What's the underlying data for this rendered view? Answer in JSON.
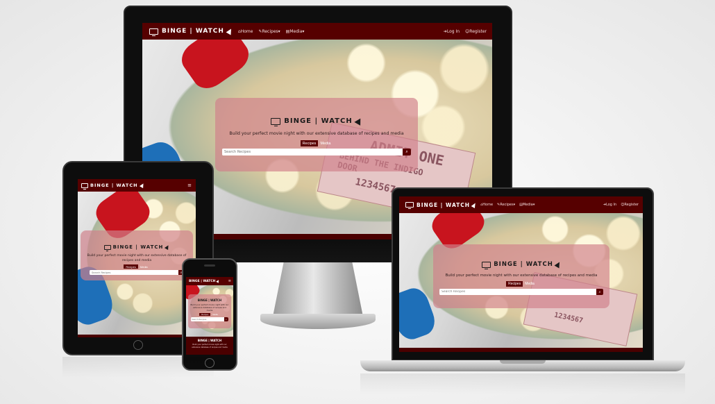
{
  "brand": {
    "name": "BINGE | WATCH"
  },
  "nav": {
    "home": "Home",
    "recipes": "Recipes",
    "media": "Media",
    "login": "Log In",
    "register": "Register"
  },
  "hero": {
    "tagline": "Build your perfect movie night with our extensive database of recipes and media",
    "tab_recipes": "Recipes",
    "tab_media": "Media",
    "search_placeholder": "Search Recipes"
  },
  "ticket": {
    "text": "ADMIT ONE",
    "sub": "BEHIND THE INDIGO DOOR",
    "number": "1234567"
  },
  "colors": {
    "brand": "#560000",
    "card": "#d0808a",
    "accent_red": "#c8141e",
    "accent_blue": "#1e6fb8"
  },
  "icons": [
    "tv-icon",
    "pizza-icon",
    "home-icon",
    "recipe-icon",
    "media-icon",
    "login-icon",
    "register-icon",
    "search-icon",
    "menu-icon"
  ]
}
